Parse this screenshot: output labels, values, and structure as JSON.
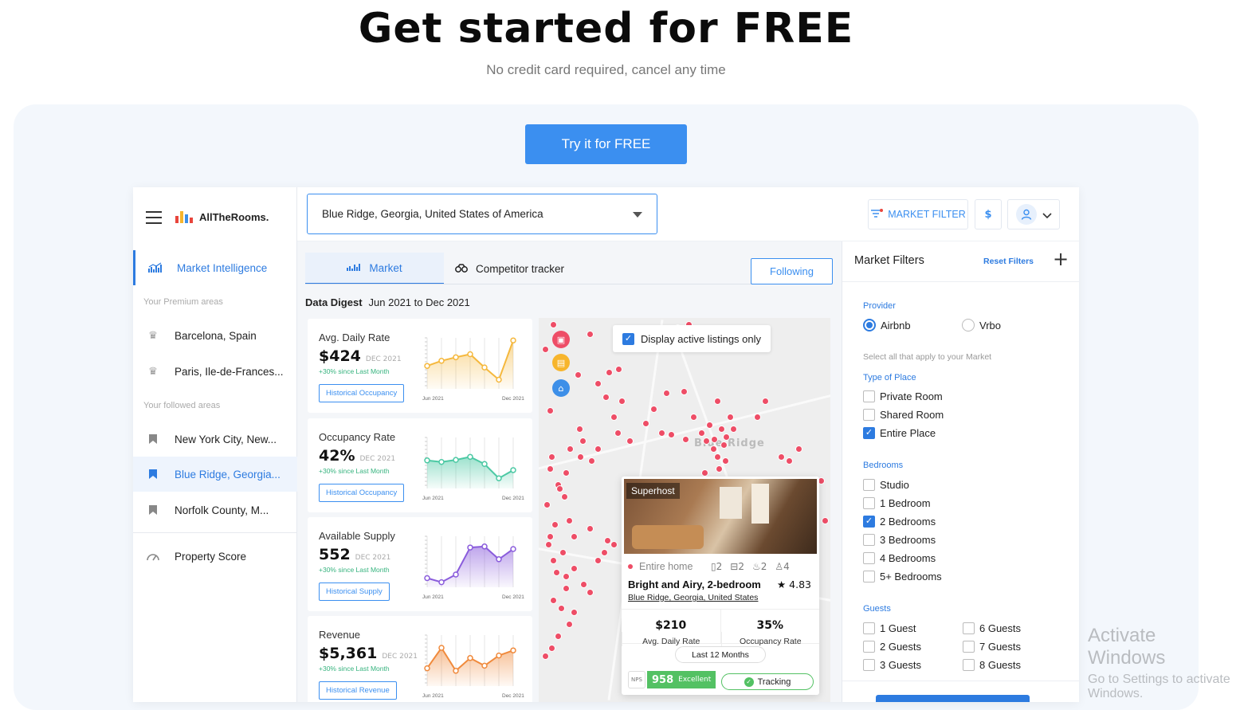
{
  "hero": {
    "title": "Get started for FREE",
    "subtitle": "No credit card required, cancel any time",
    "cta": "Try it for FREE"
  },
  "brand": {
    "name": "AllTheRooms.",
    "colors": [
      "#e8453c",
      "#f7b52c",
      "#3d8fe8"
    ]
  },
  "sidebar": {
    "main_item": "Market Intelligence",
    "premium_caption": "Your Premium areas",
    "premium_areas": [
      "Barcelona, Spain",
      "Paris, Ile-de-Frances..."
    ],
    "followed_caption": "Your followed areas",
    "followed_areas": [
      "New York City, New...",
      "Blue Ridge, Georgia...",
      "Norfolk County, M..."
    ],
    "selected_index": 1,
    "property_score": "Property Score"
  },
  "topbar": {
    "location": "Blue Ridge, Georgia, United States of America",
    "market_filter": "MARKET FILTER",
    "currency": "$"
  },
  "tabs": {
    "market": "Market",
    "competitor": "Competitor tracker",
    "following": "Following"
  },
  "digest": {
    "label": "Data Digest",
    "range": "Jun 2021 to Dec 2021"
  },
  "metrics": [
    {
      "label": "Avg. Daily Rate",
      "value": "$424",
      "date": "DEC 2021",
      "change": "+30% since Last Month",
      "button": "Historical Occupancy",
      "color": "#f5b83d",
      "series": [
        0.45,
        0.55,
        0.62,
        0.68,
        0.42,
        0.18,
        0.95
      ]
    },
    {
      "label": "Occupancy Rate",
      "value": "42%",
      "date": "DEC 2021",
      "change": "+30% since Last Month",
      "button": "Historical Occupancy",
      "color": "#4cc9a4",
      "series": [
        0.55,
        0.52,
        0.56,
        0.62,
        0.48,
        0.2,
        0.36
      ]
    },
    {
      "label": "Available Supply",
      "value": "552",
      "date": "DEC 2021",
      "change": "+30% since Last Month",
      "button": "Historical Supply",
      "color": "#8a5cdc",
      "series": [
        0.18,
        0.1,
        0.25,
        0.78,
        0.8,
        0.55,
        0.75
      ]
    },
    {
      "label": "Revenue",
      "value": "$5,361",
      "date": "DEC 2021",
      "change": "+30% since Last Month",
      "button": "Historical Revenue",
      "color": "#f08a3c",
      "series": [
        0.35,
        0.75,
        0.3,
        0.55,
        0.4,
        0.6,
        0.7
      ]
    }
  ],
  "chart_axis": {
    "start": "Jun 2021",
    "end": "Dec 2021"
  },
  "map": {
    "checkbox_label": "Display active listings only",
    "checked": true,
    "labels": [
      "Blue Ridge"
    ]
  },
  "listing": {
    "badge": "Superhost",
    "type": "Entire home",
    "features": [
      "2",
      "2",
      "2",
      "4"
    ],
    "title": "Bright and Airy, 2-bedroom",
    "rating": "★ 4.83",
    "location": "Blue Ridge, Georgia, United States",
    "adr_value": "$210",
    "adr_label": "Avg. Daily Rate",
    "occ_value": "35%",
    "occ_label": "Occupancy Rate",
    "period": "Last 12 Months",
    "score": "958",
    "score_label": "Excellent",
    "score_glyph": "NPS",
    "tracking": "Tracking"
  },
  "filters": {
    "title": "Market Filters",
    "reset": "Reset Filters",
    "provider_caption": "Provider",
    "providers": [
      {
        "label": "Airbnb",
        "on": true
      },
      {
        "label": "Vrbo",
        "on": false
      }
    ],
    "note": "Select all that apply to your Market",
    "type_caption": "Type of Place",
    "types": [
      {
        "label": "Private Room",
        "on": false
      },
      {
        "label": "Shared Room",
        "on": false
      },
      {
        "label": "Entire Place",
        "on": true
      }
    ],
    "bedrooms_caption": "Bedrooms",
    "bedrooms": [
      {
        "label": "Studio",
        "on": false
      },
      {
        "label": "1 Bedroom",
        "on": false
      },
      {
        "label": "2 Bedrooms",
        "on": true
      },
      {
        "label": "3 Bedrooms",
        "on": false
      },
      {
        "label": "4 Bedrooms",
        "on": false
      },
      {
        "label": "5+ Bedrooms",
        "on": false
      }
    ],
    "guests_caption": "Guests",
    "guests_left": [
      "1 Guest",
      "2 Guests",
      "3 Guests"
    ],
    "guests_right": [
      "6 Guests",
      "7 Guests",
      "8 Guests"
    ]
  },
  "watermark": {
    "line1": "Activate Windows",
    "line2": "Go to Settings to activate Windows."
  }
}
